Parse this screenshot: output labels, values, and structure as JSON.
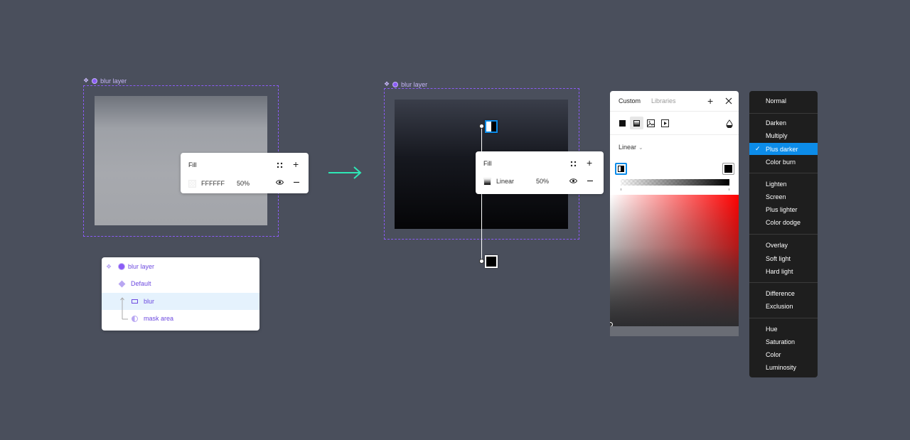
{
  "left_frame": {
    "label": "blur layer"
  },
  "left_fill": {
    "title": "Fill",
    "hex": "FFFFFF",
    "opacity": "50%"
  },
  "layers": {
    "items": [
      {
        "label": "blur layer",
        "icon": "component-dot-icon"
      },
      {
        "label": "Default",
        "icon": "diamond-icon"
      },
      {
        "label": "blur",
        "icon": "rectangle-icon"
      },
      {
        "label": "mask area",
        "icon": "mask-icon"
      }
    ]
  },
  "right_frame": {
    "label": "blur layer"
  },
  "right_fill": {
    "title": "Fill",
    "type": "Linear",
    "opacity": "50%"
  },
  "color_picker": {
    "tabs": [
      "Custom",
      "Libraries"
    ],
    "gradient_type": "Linear",
    "gradient_type_caret": "⌄",
    "fill_types": [
      "solid-icon",
      "gradient-icon",
      "image-icon",
      "video-icon"
    ],
    "blend_icon": "blend-mode-icon"
  },
  "blend_menu": {
    "groups": [
      [
        "Normal"
      ],
      [
        "Darken",
        "Multiply",
        "Plus darker",
        "Color burn"
      ],
      [
        "Lighten",
        "Screen",
        "Plus lighter",
        "Color dodge"
      ],
      [
        "Overlay",
        "Soft light",
        "Hard light"
      ],
      [
        "Difference",
        "Exclusion"
      ],
      [
        "Hue",
        "Saturation",
        "Color",
        "Luminosity"
      ]
    ],
    "selected": "Plus darker",
    "check_glyph": "✓"
  },
  "colors": {
    "accent": "#0c8ce9",
    "frame": "#8b5cf6",
    "arrow": "#2ee8b6",
    "background": "#4a4f5c"
  }
}
